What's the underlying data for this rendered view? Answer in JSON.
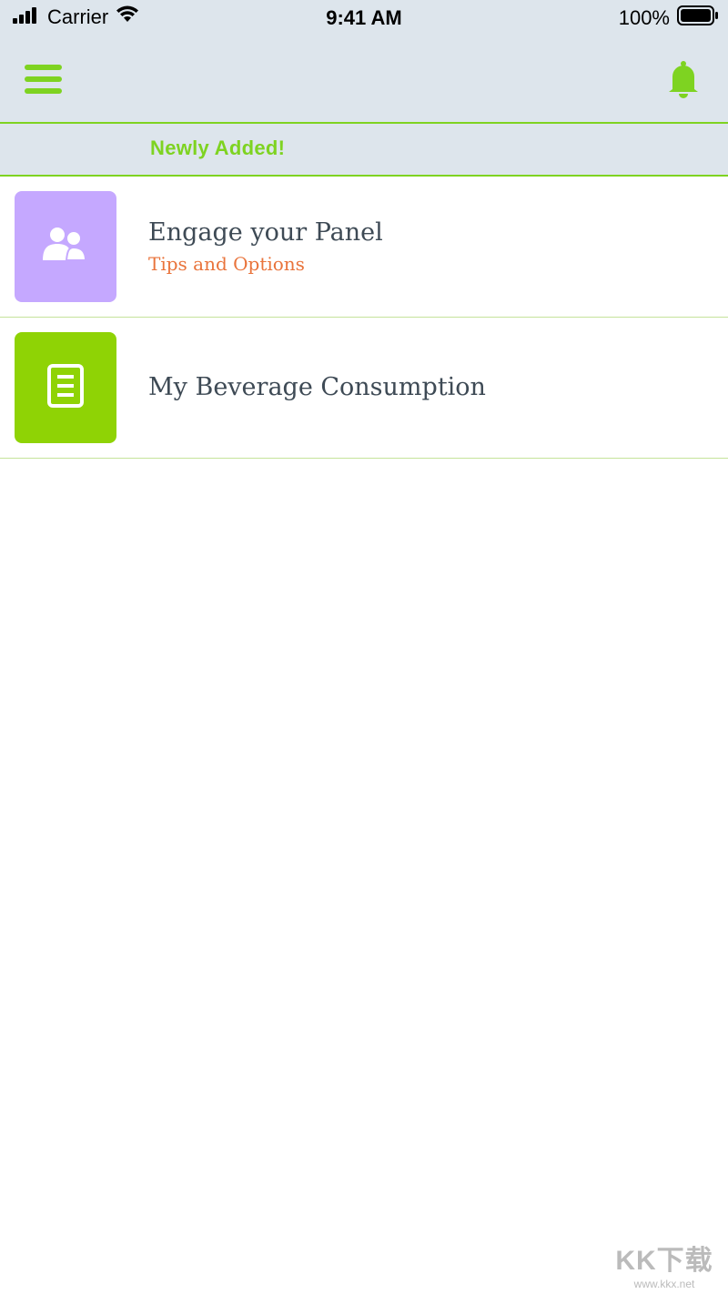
{
  "status_bar": {
    "carrier": "Carrier",
    "time": "9:41 AM",
    "battery": "100%"
  },
  "header": {
    "menu_icon": "hamburger-menu-icon",
    "notification_icon": "bell-icon",
    "accent_color": "#7ed321"
  },
  "section": {
    "title": "Newly Added!"
  },
  "items": [
    {
      "title": "Engage your Panel",
      "subtitle": "Tips and Options",
      "icon": "users-icon",
      "tile_color": "#c5a8ff"
    },
    {
      "title": "My Beverage Consumption",
      "icon": "document-icon",
      "tile_color": "#8fd305"
    }
  ],
  "watermark": {
    "brand": "KK下载",
    "url": "www.kkx.net"
  }
}
